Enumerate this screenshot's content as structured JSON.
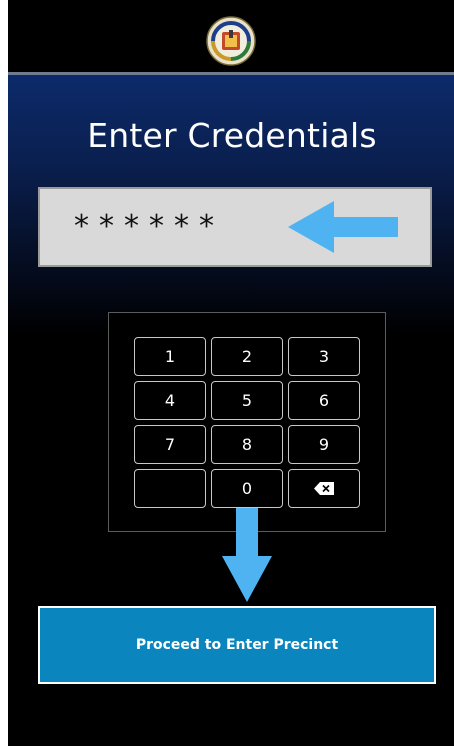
{
  "header": {
    "seal_icon": "county-seal-icon",
    "seal_text": "COUNTY OF LOS ANGELES · CALIFORNIA"
  },
  "screen": {
    "title": "Enter Credentials",
    "credential_value": "******",
    "arrow_color": "#4fb3f2"
  },
  "keypad": {
    "keys": [
      {
        "label": "1"
      },
      {
        "label": "2"
      },
      {
        "label": "3"
      },
      {
        "label": "4"
      },
      {
        "label": "5"
      },
      {
        "label": "6"
      },
      {
        "label": "7"
      },
      {
        "label": "8"
      },
      {
        "label": "9"
      },
      {
        "label": ""
      },
      {
        "label": "0"
      },
      {
        "label": "",
        "icon": "backspace-icon"
      }
    ]
  },
  "actions": {
    "proceed_label": "Proceed to Enter Precinct",
    "proceed_color": "#0a85bd"
  }
}
